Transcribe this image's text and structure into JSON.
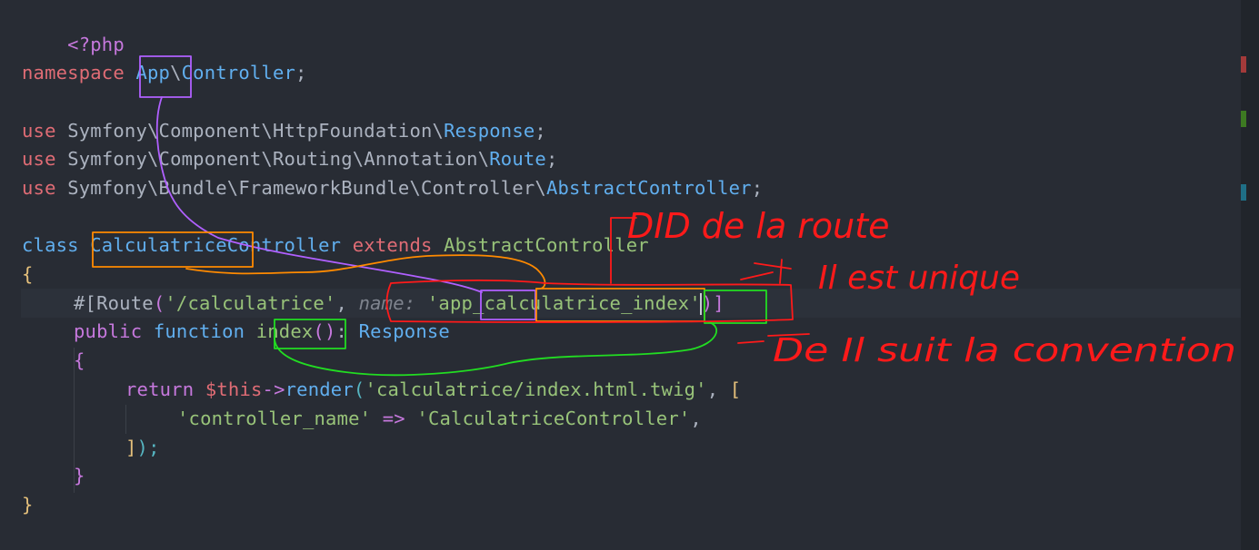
{
  "code": {
    "php_open": "<?php",
    "namespace_kw": "namespace",
    "namespace_app": "App",
    "namespace_sep": "\\",
    "namespace_rest": "Controller",
    "semicolon": ";",
    "use_kw": "use",
    "use1_path": "Symfony\\Component\\HttpFoundation\\",
    "use1_class": "Response",
    "use2_path": "Symfony\\Component\\Routing\\Annotation\\",
    "use2_class": "Route",
    "use3_path": "Symfony\\Bundle\\FrameworkBundle\\Controller\\",
    "use3_class": "AbstractController",
    "class_kw": "class",
    "class_name": "CalculatriceController",
    "extends_kw": "extends",
    "parent_class": "AbstractController",
    "open_brace": "{",
    "close_brace": "}",
    "attr_start": "#[",
    "attr_name": "Route",
    "route_path": "'/calculatrice'",
    "comma": ",",
    "param_name": "name:",
    "route_name": "'app_calculatrice_index'",
    "attr_end": ")]",
    "public_kw": "public",
    "function_kw": "function",
    "method_name": "index",
    "parens": "()",
    "colon": ":",
    "return_type": "Response",
    "return_kw": "return",
    "this_var": "$this",
    "arrow": "->",
    "render_fn": "render",
    "template": "'calculatrice/index.html.twig'",
    "array_open": "[",
    "key_name": "'controller_name'",
    "fat_arrow": "=>",
    "key_value": "'CalculatriceController'",
    "array_close": "]",
    "call_close": ");"
  },
  "annotations": {
    "note1": "DID de la route",
    "note2": "Il est unique",
    "note3": "De Il suit la convention"
  },
  "colors": {
    "background": "#282c34",
    "keyword": "#e06c75",
    "storage": "#c678dd",
    "class": "#61afef",
    "string": "#98c379",
    "annotation_red": "#ff1a1a",
    "annotation_purple": "#b060ff",
    "annotation_orange": "#ff8a00",
    "annotation_green": "#22dd22"
  }
}
